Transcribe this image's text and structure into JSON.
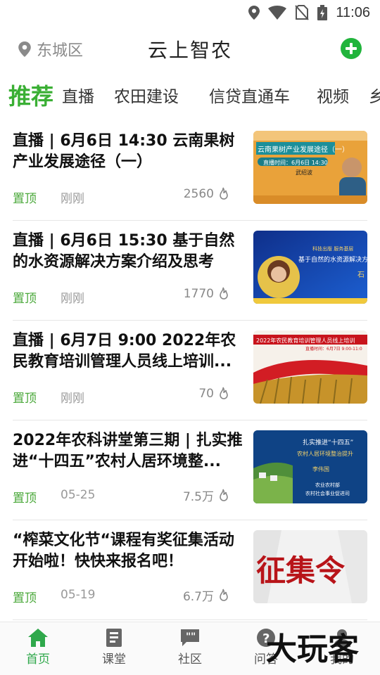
{
  "status_bar": {
    "time": "11:06",
    "icons": [
      "location-icon",
      "wifi-icon",
      "no-sim-icon",
      "battery-icon"
    ]
  },
  "header": {
    "location": "东城区",
    "title": "云上智农",
    "add_icon": "plus-circle-icon",
    "accent": "#21b43c"
  },
  "tabs": [
    {
      "label": "推荐",
      "active": true
    },
    {
      "label": "直播"
    },
    {
      "label": "农田建设"
    },
    {
      "label": "信贷直通车"
    },
    {
      "label": "视频"
    },
    {
      "label": "乡"
    }
  ],
  "feed": [
    {
      "title": "直播 | 6月6日 14:30 云南果树产业发展途径（一）",
      "pin": "置顶",
      "date": "刚刚",
      "views": "2560",
      "thumb": {
        "headline": "云南果树产业发展途径（一）",
        "sub": "直播时间：6月6日 14:30",
        "name": "武绍波"
      }
    },
    {
      "title": "直播 | 6月6日 15:30 基于自然的水资源解决方案介绍及思考",
      "pin": "置顶",
      "date": "刚刚",
      "views": "1770",
      "thumb": {
        "headline": "基于自然的水资源解决方案介绍及",
        "sub": "科技出版 服务基层",
        "name": "石"
      }
    },
    {
      "title": "直播 | 6月7日 9:00  2022年农民教育培训管理人员线上培训...",
      "pin": "置顶",
      "date": "刚刚",
      "views": "70",
      "thumb": {
        "headline": "2022年农民教育培训管理人员线上培训",
        "sub": "直播时间：6月7日 9:00-11:0",
        "name": ""
      }
    },
    {
      "title": "2022年农科讲堂第三期 | 扎实推进“十四五”农村人居环境整...",
      "pin": "置顶",
      "date": "05-25",
      "views": "7.5万",
      "thumb": {
        "headline": "扎实推进“十四五”",
        "sub": "农村人居环境整治提升",
        "name": "李伟国",
        "org1": "农业农村部",
        "org2": "农村社会事业促进司"
      }
    },
    {
      "title": "“榨菜文化节“课程有奖征集活动开始啦！快快来报名吧！",
      "pin": "置顶",
      "date": "05-19",
      "views": "6.7万",
      "thumb": {
        "headline": "征集令"
      }
    }
  ],
  "bottom_nav": [
    {
      "label": "首页",
      "icon": "home-icon",
      "active": true
    },
    {
      "label": "课堂",
      "icon": "book-icon"
    },
    {
      "label": "社区",
      "icon": "chat-quote-icon"
    },
    {
      "label": "问答",
      "icon": "question-icon"
    },
    {
      "label": "我的",
      "icon": "user-icon"
    }
  ],
  "watermark": "大玩客"
}
